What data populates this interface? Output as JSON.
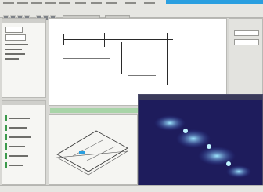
{
  "app": {
    "title": "",
    "menu": [
      "",
      "",
      "",
      "",
      "",
      "",
      "",
      "",
      "",
      "",
      "",
      "",
      "",
      "",
      "",
      "",
      "",
      "",
      ""
    ],
    "toolbar_count": 0
  },
  "colors": {
    "window_bg": "#d8d8d4",
    "title_accent": "#2a9fe0",
    "viewport_bg": "#1e1c5c",
    "highlight_blue": "#7fd8ff",
    "tree_green": "#3c9a4c"
  },
  "icons": {
    "tools": [
      "select-tool-icon",
      "line-tool-icon",
      "arc-tool-icon",
      "dimension-tool-icon",
      "zoom-icon",
      "pan-icon",
      "rotate-icon"
    ]
  },
  "panels": {
    "left_top": {
      "title": ""
    },
    "left_bottom": {
      "title": ""
    },
    "render": {
      "title": ""
    }
  },
  "status": {
    "text": ""
  }
}
